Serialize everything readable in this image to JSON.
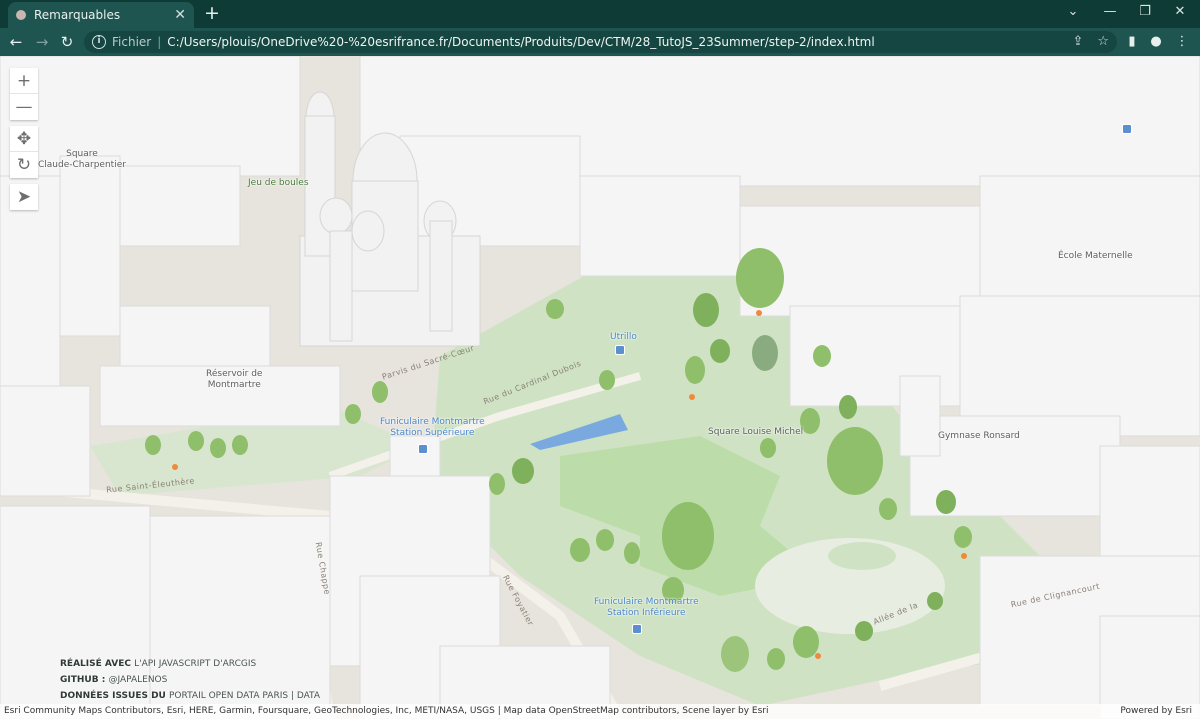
{
  "browser": {
    "tab_title": "Remarquables",
    "new_tab_label": "+",
    "close_tab_label": "✕",
    "window_minimize": "—",
    "window_restore": "❐",
    "window_close": "✕",
    "scheme_label": "Fichier",
    "separator": "|",
    "url": "C:/Users/plouis/OneDrive%20-%20esrifrance.fr/Documents/Produits/Dev/CTM/28_TutoJS_23Summer/step-2/index.html"
  },
  "map_controls": {
    "zoom_in": "+",
    "zoom_out": "—",
    "pan": "✥",
    "rotate": "↻",
    "compass": "➤"
  },
  "places": {
    "square_claude": "Square\nClaude-Charpentier",
    "jeu_de_boules": "Jeu de boules",
    "reservoir": "Réservoir de\nMontmartre",
    "funiculaire_sup": "Funiculaire Montmartre\nStation Supérieure",
    "utrillo": "Utrillo",
    "square_louise_michel": "Square Louise Michel",
    "ecole": "École Maternelle",
    "gymnase": "Gymnase Ronsard",
    "funiculaire_inf": "Funiculaire Montmartre\nStation Inférieure"
  },
  "streets": {
    "parvis": "Parvis du Sacré-Cœur",
    "cardinal": "Rue du Cardinal Dubois",
    "saint_eleuthere": "Rue Saint-Éleuthère",
    "chappe": "Rue Chappe",
    "foyatier": "Rue Foyatier",
    "allee": "Allée de la",
    "clignancourt": "Rue de Clignancourt"
  },
  "credits": {
    "line1_prefix": "RÉALISÉ AVEC",
    "line1_link": "L'API JAVASCRIPT D'ARCGIS",
    "line2_prefix": "GITHUB :",
    "line2_link": "@JAPALENOS",
    "line3_prefix": "DONNÉES ISSUES DU",
    "line3_link": "PORTAIL OPEN DATA PARIS | DATA"
  },
  "attribution": {
    "text": "Esri Community Maps Contributors, Esri, HERE, Garmin, Foursquare, GeoTechnologies, Inc, METI/NASA, USGS | Map data OpenStreetMap contributors, Scene layer by Esri",
    "powered": "Powered by Esri"
  }
}
